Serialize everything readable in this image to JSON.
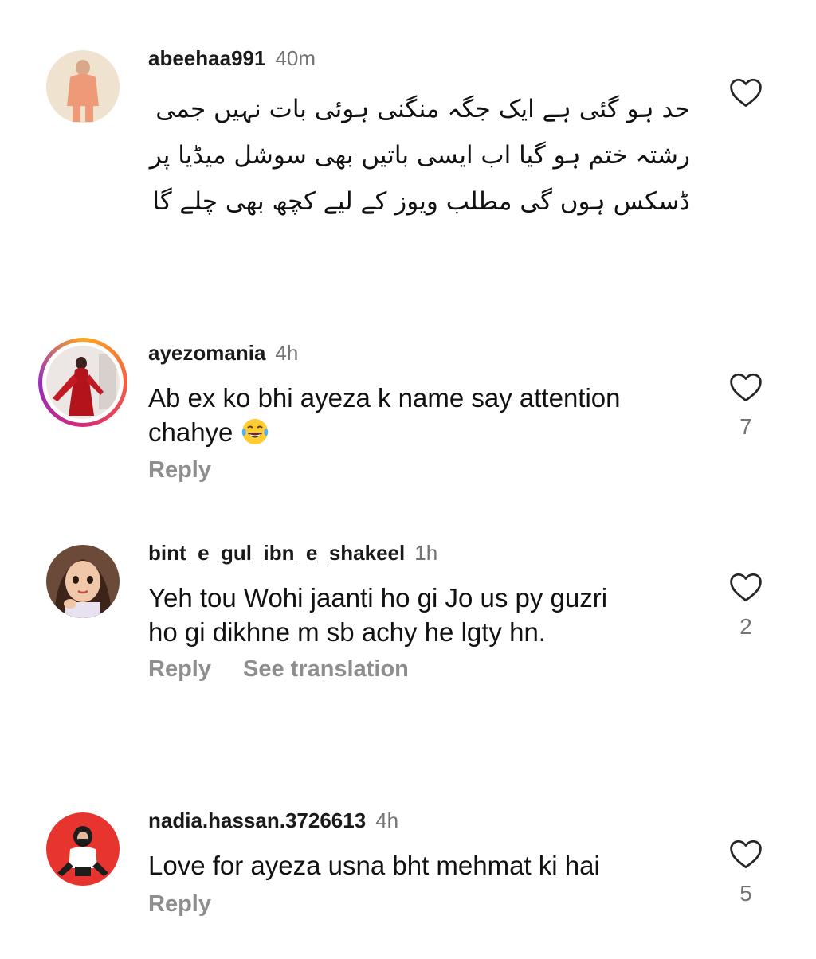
{
  "comments": [
    {
      "username": "abeehaa991",
      "time": "40m",
      "lines": [
        "حد ہو گئی ہے ایک جگہ منگنی ہوئی بات نہیں جمی",
        "رشتہ ختم ہو گیا اب ایسی باتیں بھی سوشل میڈیا پر",
        "ڈسکس ہوں گی مطلب ویوز کے لیے کچھ بھی چلے گا"
      ],
      "likes": ""
    },
    {
      "username": "ayezomania",
      "time": "4h",
      "text_line1": "Ab ex ko bhi ayeza k name say attention",
      "text_line2": "chahye",
      "emoji": "laughing-tears",
      "reply": "Reply",
      "likes": "7"
    },
    {
      "username": "bint_e_gul_ibn_e_shakeel",
      "time": "1h",
      "text_line1": "Yeh tou Wohi jaanti ho gi Jo us py guzri",
      "text_line2": "ho gi dikhne m sb achy he lgty hn.",
      "reply": "Reply",
      "see_translation": "See translation",
      "likes": "2"
    },
    {
      "username": "nadia.hassan.3726613",
      "time": "4h",
      "text_line1": "Love for ayeza usna bht mehmat ki hai",
      "reply": "Reply",
      "likes": "5"
    }
  ],
  "colors": {
    "username": "#1a1a1a",
    "secondary": "#737373",
    "action": "#8e8e8e",
    "heart_stroke": "#262626",
    "story_ring": [
      "#f9a825",
      "#d62976",
      "#962fbf"
    ]
  },
  "icons": {
    "like": "heart-outline-icon"
  }
}
